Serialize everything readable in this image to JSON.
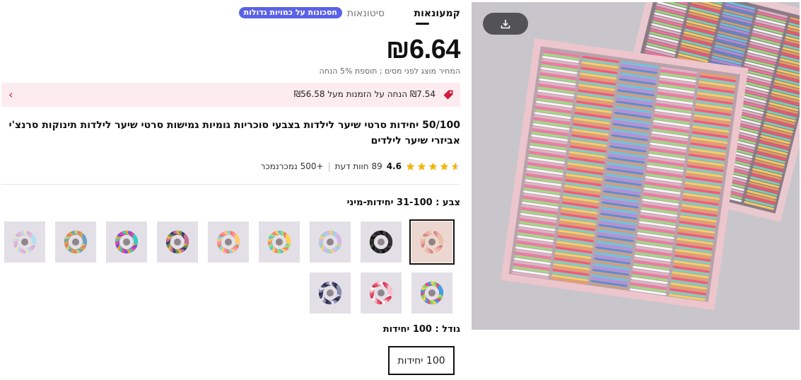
{
  "tabs": {
    "retail": "קמעונאות",
    "wholesale": "סיטונאות",
    "bulk_badge": "חסכונות על כמויות גדולות"
  },
  "price": {
    "value": "₪6.64",
    "note": "המחיר מוצג לפני מסים ; תוספת 5% הנחה"
  },
  "promo": {
    "text": "₪7.54 הנחה על הזמנות מעל ₪56.58",
    "accent": "#d21b3c",
    "background": "#fdecef"
  },
  "product": {
    "title": "50/100 יחידות סרטי שיער לילדות בצבעי סוכריות גומיות גמישות סרטי שיער לילדות תינוקות סרנצ'י אביזרי שיער לילדים"
  },
  "rating": {
    "value": "4.6",
    "reviews": "89 חוות דעת",
    "sold": "+500 נמכרנמכר",
    "stars": 4.6
  },
  "color_label": "צבע : 31-100 יחידות-מיני",
  "size_label": "גודל : 100 יחידות",
  "size_option": "100 יחידות",
  "swatches": [
    {
      "name": "swatch-1",
      "selected": true
    },
    {
      "name": "swatch-2",
      "selected": false
    },
    {
      "name": "swatch-3",
      "selected": false
    },
    {
      "name": "swatch-4",
      "selected": false
    },
    {
      "name": "swatch-5",
      "selected": false
    },
    {
      "name": "swatch-6",
      "selected": false
    },
    {
      "name": "swatch-7",
      "selected": false
    },
    {
      "name": "swatch-8",
      "selected": false
    },
    {
      "name": "swatch-9",
      "selected": false
    },
    {
      "name": "swatch-10",
      "selected": false
    },
    {
      "name": "swatch-11",
      "selected": false
    },
    {
      "name": "swatch-12",
      "selected": false
    }
  ],
  "icons": {
    "download": "download-icon",
    "promo": "tag-icon",
    "chevron": "chevron-right-icon",
    "star": "star-icon"
  },
  "colors": {
    "star": "#f5b400",
    "badge": "#5b62e6"
  }
}
